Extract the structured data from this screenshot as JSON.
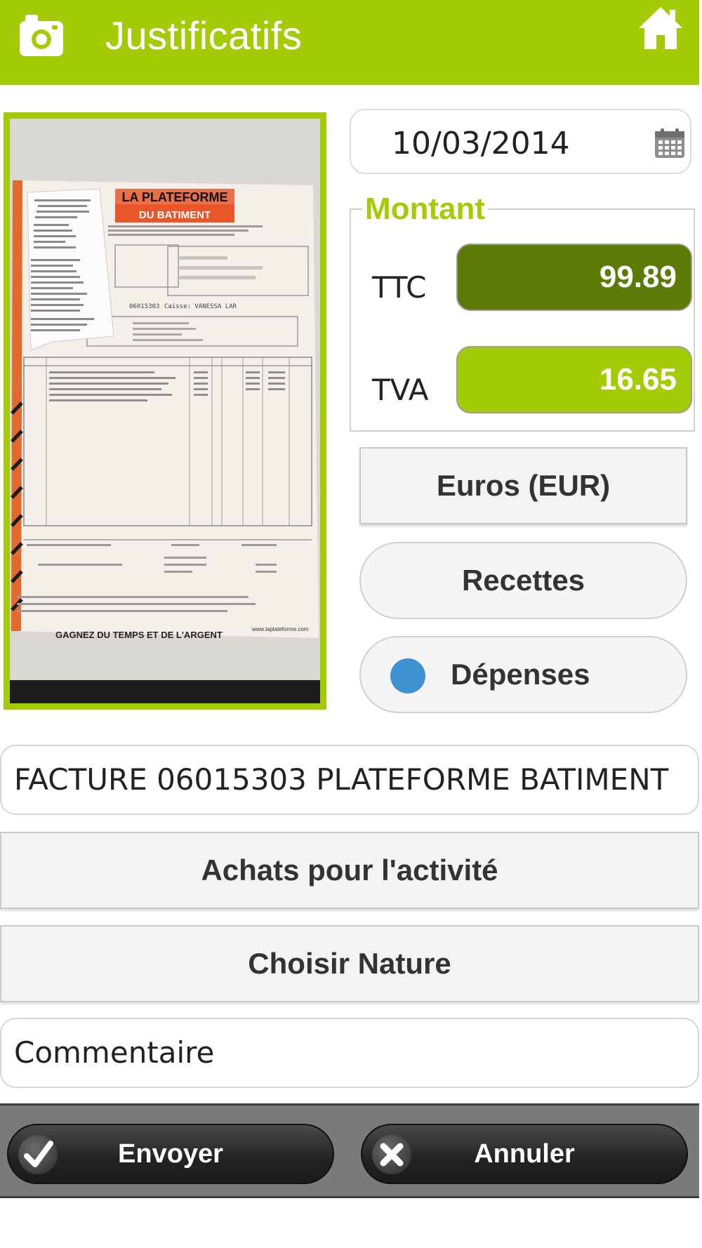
{
  "header": {
    "title": "Justificatifs",
    "color": "#a3cc06",
    "left_icon": "camera-icon",
    "right_icon": "home-icon"
  },
  "receipt": {
    "company_top": "LA PLATEFORME",
    "company_bottom": "DU BATIMENT",
    "invoice_no": "06015303",
    "cashier": "Caisse: VANESSA LAR",
    "footer_slogan": "GAGNEZ DU TEMPS ET DE L'ARGENT",
    "footer_url": "www.laplateforme.com"
  },
  "date": {
    "value": "10/03/2014",
    "icon": "calendar-icon"
  },
  "montant": {
    "legend": "Montant",
    "ttc_label": "TTC",
    "ttc_value": "99.89",
    "tva_label": "TVA",
    "tva_value": "16.65"
  },
  "currency_label": "Euros (EUR)",
  "type": {
    "recettes_label": "Recettes",
    "depenses_label": "Dépenses",
    "selected": "Dépenses"
  },
  "description": "FACTURE 06015303 PLATEFORME BATIMENT",
  "category_label": "Achats pour l'activité",
  "nature_label": "Choisir Nature",
  "comment_placeholder": "Commentaire",
  "actions": {
    "send_label": "Envoyer",
    "cancel_label": "Annuler"
  }
}
